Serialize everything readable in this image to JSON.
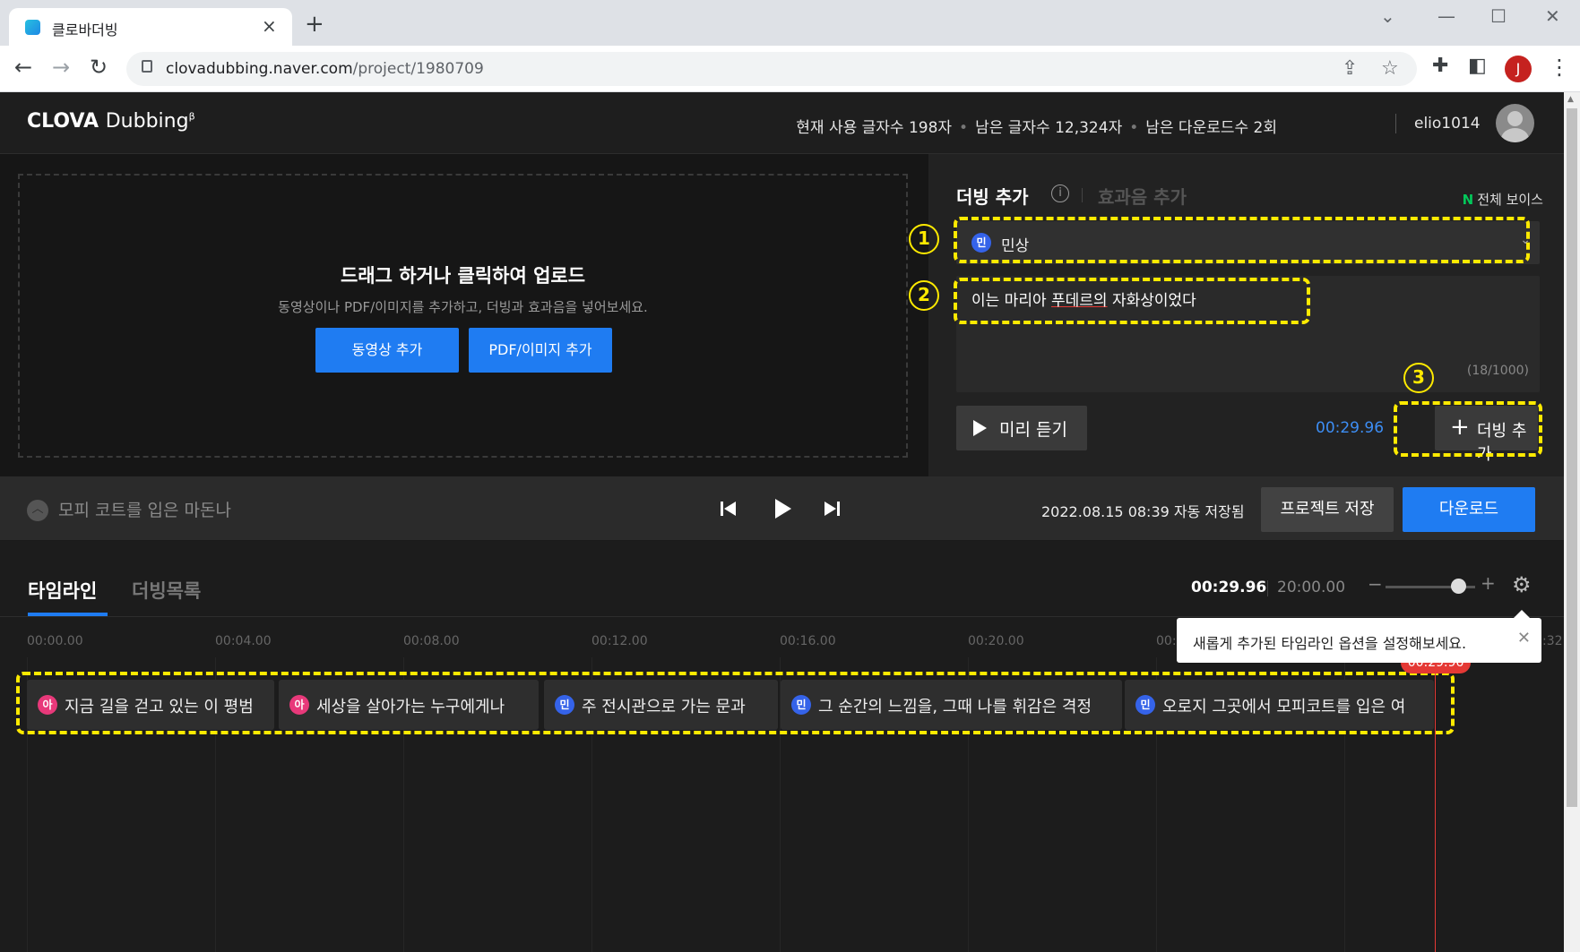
{
  "browser": {
    "tab_title": "클로바더빙",
    "url_host": "clovadubbing.naver.com",
    "url_path": "/project/1980709",
    "profile_initial": "J"
  },
  "header": {
    "logo_bold": "CLOVA",
    "logo_rest": "Dubbing",
    "logo_beta": "β",
    "usage_used": "현재 사용 글자수 198자",
    "usage_left": "남은 글자수 12,324자",
    "usage_downloads": "남은 다운로드수 2회",
    "username": "elio1014"
  },
  "upload": {
    "title": "드래그 하거나 클릭하여 업로드",
    "subtitle": "동영상이나 PDF/이미지를 추가하고, 더빙과 효과음을 넣어보세요.",
    "add_video": "동영상 추가",
    "add_pdf": "PDF/이미지 추가"
  },
  "dub_panel": {
    "tab_dub": "더빙 추가",
    "tab_sfx": "효과음 추가",
    "all_voices_badge": "N",
    "all_voices": "전체 보이스",
    "voice_chip": "민",
    "voice_name": "민상",
    "text_before": "이는 마리아 ",
    "text_underlined": "푸데르의",
    "text_after": " 자화상이었다",
    "char_count": "(18/1000)",
    "preview_label": "미리 듣기",
    "duration": "00:29.96",
    "add_label": "더빙 추가"
  },
  "annotations": {
    "n1": "1",
    "n2": "2",
    "n3": "3",
    "color": "#ffea00"
  },
  "control_bar": {
    "project_title": "모피 코트를 입은 마돈나",
    "saved_at": "2022.08.15 08:39 자동 저장됨",
    "save_btn": "프로젝트 저장",
    "download_btn": "다운로드"
  },
  "timeline": {
    "tab_timeline": "타임라인",
    "tab_list": "더빙목록",
    "current_time": "00:29.96",
    "total_time": "20:00.00",
    "ticks": [
      "00:00.00",
      "00:04.00",
      "00:08.00",
      "00:12.00",
      "00:16.00",
      "00:20.00"
    ],
    "tick_partial": "00:",
    "tick_partial_right": ":32",
    "playhead_label": "00:29.96",
    "tooltip": "새롭게 추가된 타임라인 옵션을 설정해보세요.",
    "clips": [
      {
        "chip": "아",
        "text": "지금 길을 걷고 있는 이 평범"
      },
      {
        "chip": "아",
        "text": "세상을 살아가는 누구에게나 "
      },
      {
        "chip": "민",
        "text": "주 전시관으로 가는 문과 "
      },
      {
        "chip": "민",
        "text": "그 순간의 느낌을, 그때 나를 휘감은 격정"
      },
      {
        "chip": "민",
        "text": "오로지 그곳에서 모피코트를 입은 여"
      }
    ]
  },
  "colors": {
    "accent_blue": "#1f7cf2",
    "playhead_red": "#e53935",
    "chip_min": "#3563e9",
    "chip_ah": "#e8397a"
  }
}
